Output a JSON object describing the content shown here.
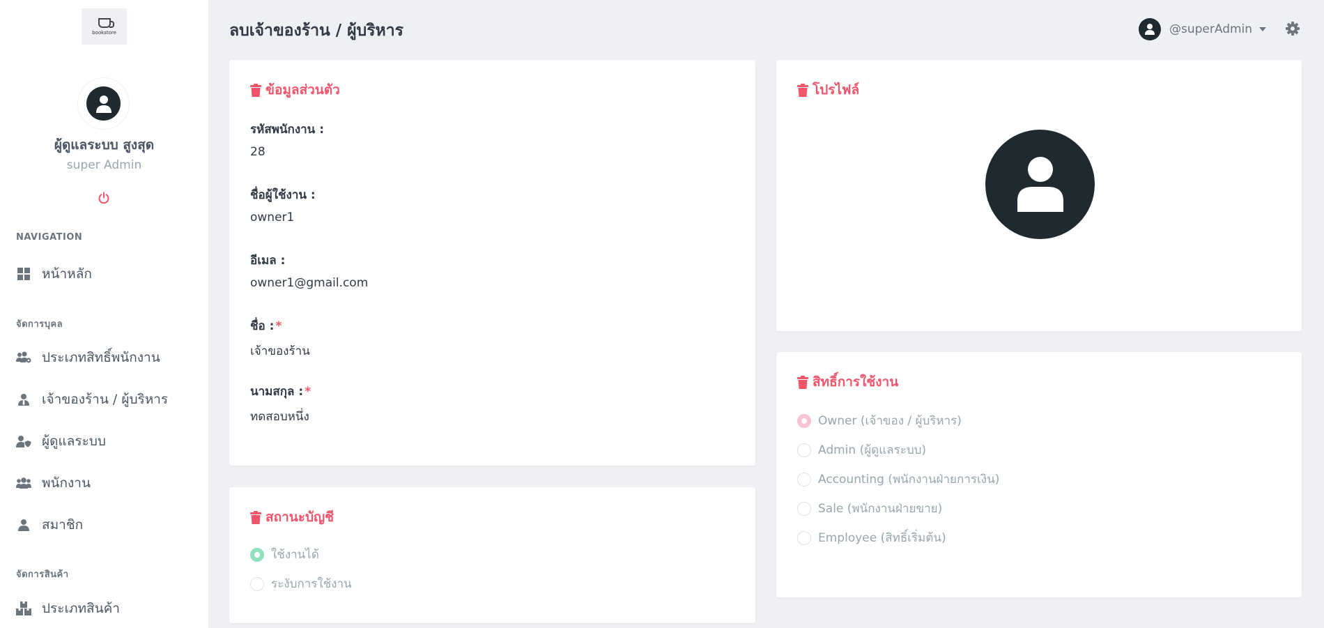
{
  "logo": {
    "text": "bookstore"
  },
  "user": {
    "name": "ผู้ดูแลระบบ สูงสุด",
    "role": "super Admin"
  },
  "sidebar": {
    "navigation_title": "NAVIGATION",
    "home": "หน้าหลัก",
    "people_title": "จัดการบุคล",
    "items": [
      {
        "label": "ประเภทสิทธิ์พนักงาน",
        "icon": "users-cog-icon"
      },
      {
        "label": "เจ้าของร้าน / ผู้บริหาร",
        "icon": "user-tie-icon"
      },
      {
        "label": "ผู้ดูแลระบบ",
        "icon": "user-shield-icon"
      },
      {
        "label": "พนักงาน",
        "icon": "users-icon"
      },
      {
        "label": "สมาชิก",
        "icon": "user-icon"
      }
    ],
    "products_title": "จัดการสินค้า",
    "product_items": [
      {
        "label": "ประเภทสินค้า",
        "icon": "boxes-icon"
      }
    ]
  },
  "header": {
    "title": "ลบเจ้าของร้าน / ผู้บริหาร",
    "username": "@superAdmin"
  },
  "personal": {
    "title": "ข้อมูลส่วนตัว",
    "employee_id_label": "รหัสพนักงาน :",
    "employee_id": "28",
    "username_label": "ชื่อผู้ใช้งาน :",
    "username": "owner1",
    "email_label": "อีเมล :",
    "email": "owner1@gmail.com",
    "firstname_label": "ชื่อ :",
    "firstname": "เจ้าของร้าน",
    "lastname_label": "นามสกุล :",
    "lastname": "ทดสอบหนึ่ง",
    "required_mark": "*"
  },
  "profile": {
    "title": "โปรไฟล์"
  },
  "account_status": {
    "title": "สถานะบัญชี",
    "options": [
      "ใช้งานได้",
      "ระงับการใช้งาน"
    ],
    "selected": 0
  },
  "permissions": {
    "title": "สิทธิ์การใช้งาน",
    "options": [
      "Owner (เจ้าของ / ผู้บริหาร)",
      "Admin (ผู้ดูแลระบบ)",
      "Accounting (พนักงานฝ่ายการเงิน)",
      "Sale (พนักงานฝ่ายขาย)",
      "Employee (สิทธิ์เริ่มต้น)"
    ],
    "selected": 0
  },
  "colors": {
    "accent_red": "#f1556c",
    "dark": "#1e2a2f",
    "success_radio": "#91e0c0",
    "owner_radio": "#f8c1d4"
  }
}
